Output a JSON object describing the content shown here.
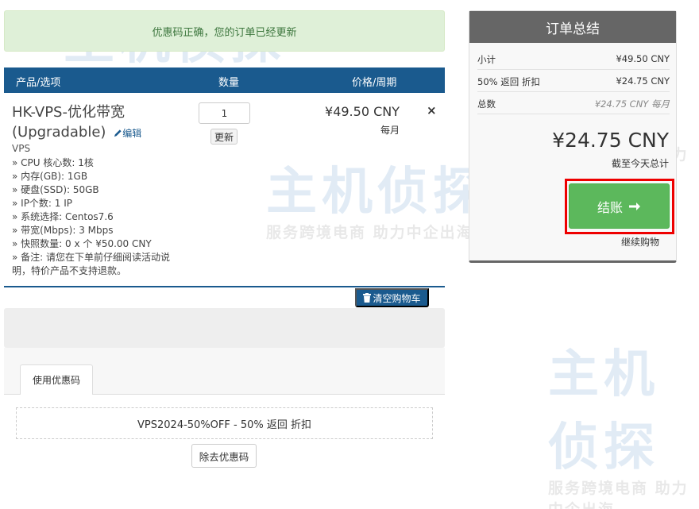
{
  "alert": {
    "message": "优惠码正确，您的订单已经更新"
  },
  "cart": {
    "headers": {
      "product": "产品/选项",
      "quantity": "数量",
      "price": "价格/周期"
    },
    "item": {
      "name": "HK-VPS-优化带宽 (Upgradable)",
      "edit_label": "编辑",
      "group": "VPS",
      "options": [
        "» CPU 核心数: 1核",
        "» 内存(GB): 1GB",
        "» 硬盘(SSD): 50GB",
        "» IP个数: 1 IP",
        "» 系统选择: Centos7.6",
        "» 带宽(Mbps): 3 Mbps",
        "» 快照数量: 0 x 个 ¥50.00 CNY",
        "» 备注: 请您在下单前仔细阅读活动说明，特价产品不支持退款。"
      ],
      "quantity_value": "1",
      "update_label": "更新",
      "price": "¥49.50 CNY",
      "cycle": "每月",
      "remove_icon": "×"
    },
    "empty_cart_label": "清空购物车"
  },
  "promo": {
    "tab_label": "使用优惠码",
    "applied": "VPS2024-50%OFF - 50% 返回 折扣",
    "remove_label": "除去优惠码"
  },
  "summary": {
    "title": "订单总结",
    "rows": [
      {
        "label": "小计",
        "value": "¥49.50 CNY"
      },
      {
        "label": "50% 返回 折扣",
        "value": "¥24.75 CNY"
      },
      {
        "label": "总数",
        "value": "¥24.75 CNY 每月"
      }
    ],
    "total": "¥24.75 CNY",
    "total_note": "截至今天总计",
    "checkout_label": "结账",
    "continue_label": "继续购物"
  },
  "watermark": {
    "brand": "主机侦探",
    "slogan": "服务跨境电商 助力中企出海"
  },
  "colors": {
    "primary": "#1a5a8e",
    "success": "#5cb85c",
    "highlight": "#ee0000",
    "alert_bg": "#dff0d8"
  }
}
